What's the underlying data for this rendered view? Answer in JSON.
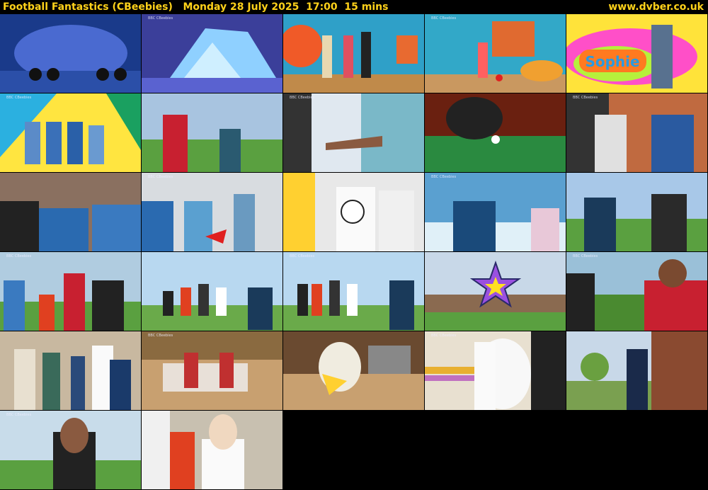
{
  "header": {
    "title": "Football Fantastics (CBeebies)   Monday 28 July 2025  17:00  15 mins",
    "site": "www.dvber.co.uk"
  },
  "thumbnails": [
    {
      "scene": "penguin-ice-cave"
    },
    {
      "scene": "blue-ice-land"
    },
    {
      "scene": "colourful-studio-presenters"
    },
    {
      "scene": "studio-ball-play"
    },
    {
      "scene": "sophie-caption",
      "caption": "Sophie"
    },
    {
      "scene": "kids-on-colour-background"
    },
    {
      "scene": "boy-in-red-jacket-field"
    },
    {
      "scene": "pointing-hand"
    },
    {
      "scene": "table-football"
    },
    {
      "scene": "two-kids-indoors"
    },
    {
      "scene": "group-of-kids-talking"
    },
    {
      "scene": "kids-in-corridor"
    },
    {
      "scene": "white-mascot-with-ball"
    },
    {
      "scene": "smiling-coach"
    },
    {
      "scene": "two-girls-on-pitch"
    },
    {
      "scene": "kids-on-field"
    },
    {
      "scene": "team-group-outdoors"
    },
    {
      "scene": "team-group-outdoors-2"
    },
    {
      "scene": "purple-star-clubhouse"
    },
    {
      "scene": "boy-red-jacket-closeup"
    },
    {
      "scene": "corridor-with-mascot"
    },
    {
      "scene": "kit-bag-closeup"
    },
    {
      "scene": "kitchen-mascot"
    },
    {
      "scene": "mascot-by-chalkboard"
    },
    {
      "scene": "man-in-garden"
    },
    {
      "scene": "girl-on-field"
    },
    {
      "scene": "girl-in-white-shirt"
    }
  ],
  "bbc_mark": "BBC CBeebies"
}
